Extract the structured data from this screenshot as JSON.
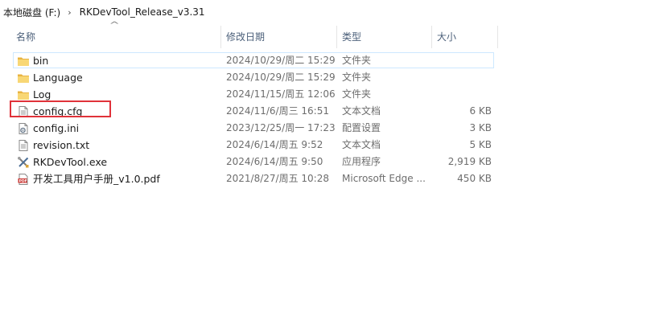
{
  "breadcrumb": {
    "drive": "本地磁盘 (F:)",
    "separator": "›",
    "folder": "RKDevTool_Release_v3.31"
  },
  "columns": {
    "name": "名称",
    "date": "修改日期",
    "type": "类型",
    "size": "大小",
    "sort_indicator": "^"
  },
  "files": [
    {
      "name": "bin",
      "date": "2024/10/29/周二 15:29",
      "type": "文件夹",
      "size": "",
      "icon": "folder-icon"
    },
    {
      "name": "Language",
      "date": "2024/10/29/周二 15:29",
      "type": "文件夹",
      "size": "",
      "icon": "folder-icon"
    },
    {
      "name": "Log",
      "date": "2024/11/15/周五 12:06",
      "type": "文件夹",
      "size": "",
      "icon": "folder-icon"
    },
    {
      "name": "config.cfg",
      "date": "2024/11/6/周三 16:51",
      "type": "文本文档",
      "size": "6 KB",
      "icon": "text-file-icon"
    },
    {
      "name": "config.ini",
      "date": "2023/12/25/周一 17:23",
      "type": "配置设置",
      "size": "3 KB",
      "icon": "settings-file-icon"
    },
    {
      "name": "revision.txt",
      "date": "2024/6/14/周五 9:52",
      "type": "文本文档",
      "size": "5 KB",
      "icon": "text-file-icon"
    },
    {
      "name": "RKDevTool.exe",
      "date": "2024/6/14/周五 9:50",
      "type": "应用程序",
      "size": "2,919 KB",
      "icon": "tools-app-icon"
    },
    {
      "name": "开发工具用户手册_v1.0.pdf",
      "date": "2021/8/27/周五 10:28",
      "type": "Microsoft Edge ...",
      "size": "450 KB",
      "icon": "pdf-file-icon"
    }
  ],
  "colors": {
    "highlight": "#e0323a",
    "hover_border": "#cde8ff",
    "folder": "#f8d775",
    "header_text": "#4c607a"
  }
}
